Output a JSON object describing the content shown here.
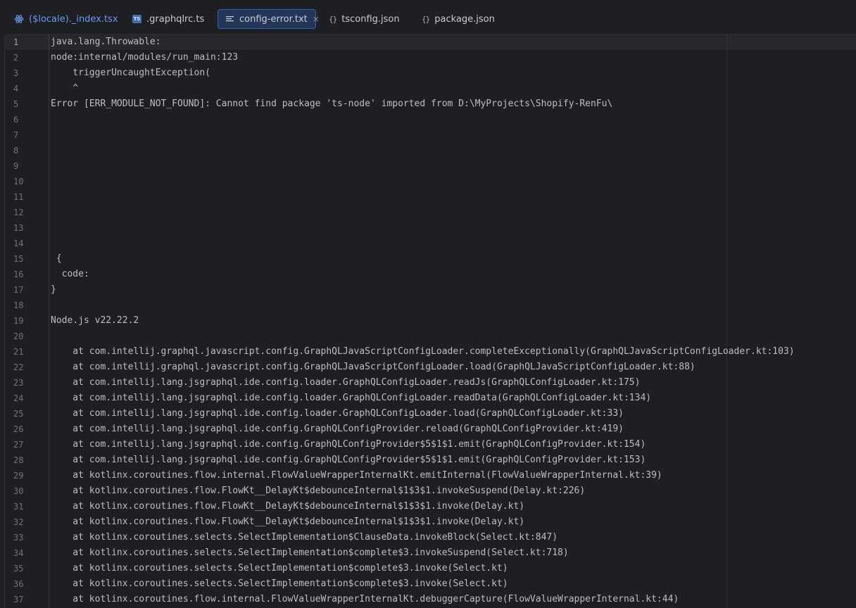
{
  "tabs": [
    {
      "label": "($locale)._index.tsx",
      "icon": "react-icon",
      "active": false
    },
    {
      "label": ".graphqlrc.ts",
      "icon": "typescript-icon",
      "icon_text": "TS",
      "active": false
    },
    {
      "label": "config-error.txt",
      "icon": "text-file-icon",
      "active": true,
      "close": "×"
    },
    {
      "label": "tsconfig.json",
      "icon": "json-icon",
      "icon_text": "{}",
      "active": false
    },
    {
      "label": "package.json",
      "icon": "json-icon",
      "icon_text": "{}",
      "active": false
    }
  ],
  "editor": {
    "current_line": 1,
    "lines": [
      "java.lang.Throwable:",
      "node:internal/modules/run_main:123",
      "    triggerUncaughtException(",
      "    ^",
      "Error [ERR_MODULE_NOT_FOUND]: Cannot find package 'ts-node' imported from D:\\MyProjects\\Shopify-RenFu\\",
      "",
      "",
      "",
      "",
      "",
      "",
      "",
      "",
      "",
      " {",
      "  code:",
      "}",
      "",
      "Node.js v22.22.2",
      "",
      "    at com.intellij.graphql.javascript.config.GraphQLJavaScriptConfigLoader.completeExceptionally(GraphQLJavaScriptConfigLoader.kt:103)",
      "    at com.intellij.graphql.javascript.config.GraphQLJavaScriptConfigLoader.load(GraphQLJavaScriptConfigLoader.kt:88)",
      "    at com.intellij.lang.jsgraphql.ide.config.loader.GraphQLConfigLoader.readJs(GraphQLConfigLoader.kt:175)",
      "    at com.intellij.lang.jsgraphql.ide.config.loader.GraphQLConfigLoader.readData(GraphQLConfigLoader.kt:134)",
      "    at com.intellij.lang.jsgraphql.ide.config.loader.GraphQLConfigLoader.load(GraphQLConfigLoader.kt:33)",
      "    at com.intellij.lang.jsgraphql.ide.config.GraphQLConfigProvider.reload(GraphQLConfigProvider.kt:419)",
      "    at com.intellij.lang.jsgraphql.ide.config.GraphQLConfigProvider$5$1$1.emit(GraphQLConfigProvider.kt:154)",
      "    at com.intellij.lang.jsgraphql.ide.config.GraphQLConfigProvider$5$1$1.emit(GraphQLConfigProvider.kt:153)",
      "    at kotlinx.coroutines.flow.internal.FlowValueWrapperInternalKt.emitInternal(FlowValueWrapperInternal.kt:39)",
      "    at kotlinx.coroutines.flow.FlowKt__DelayKt$debounceInternal$1$3$1.invokeSuspend(Delay.kt:226)",
      "    at kotlinx.coroutines.flow.FlowKt__DelayKt$debounceInternal$1$3$1.invoke(Delay.kt)",
      "    at kotlinx.coroutines.flow.FlowKt__DelayKt$debounceInternal$1$3$1.invoke(Delay.kt)",
      "    at kotlinx.coroutines.selects.SelectImplementation$ClauseData.invokeBlock(Select.kt:847)",
      "    at kotlinx.coroutines.selects.SelectImplementation$complete$3.invokeSuspend(Select.kt:718)",
      "    at kotlinx.coroutines.selects.SelectImplementation$complete$3.invoke(Select.kt)",
      "    at kotlinx.coroutines.selects.SelectImplementation$complete$3.invoke(Select.kt)",
      "    at kotlinx.coroutines.flow.internal.FlowValueWrapperInternalKt.debuggerCapture(FlowValueWrapperInternal.kt:44)"
    ]
  },
  "colors": {
    "background": "#1e1f22",
    "active_tab_bg": "#233558",
    "active_tab_border": "#3b5fa3",
    "text": "#bcbec4",
    "line_number": "#6f737a"
  }
}
